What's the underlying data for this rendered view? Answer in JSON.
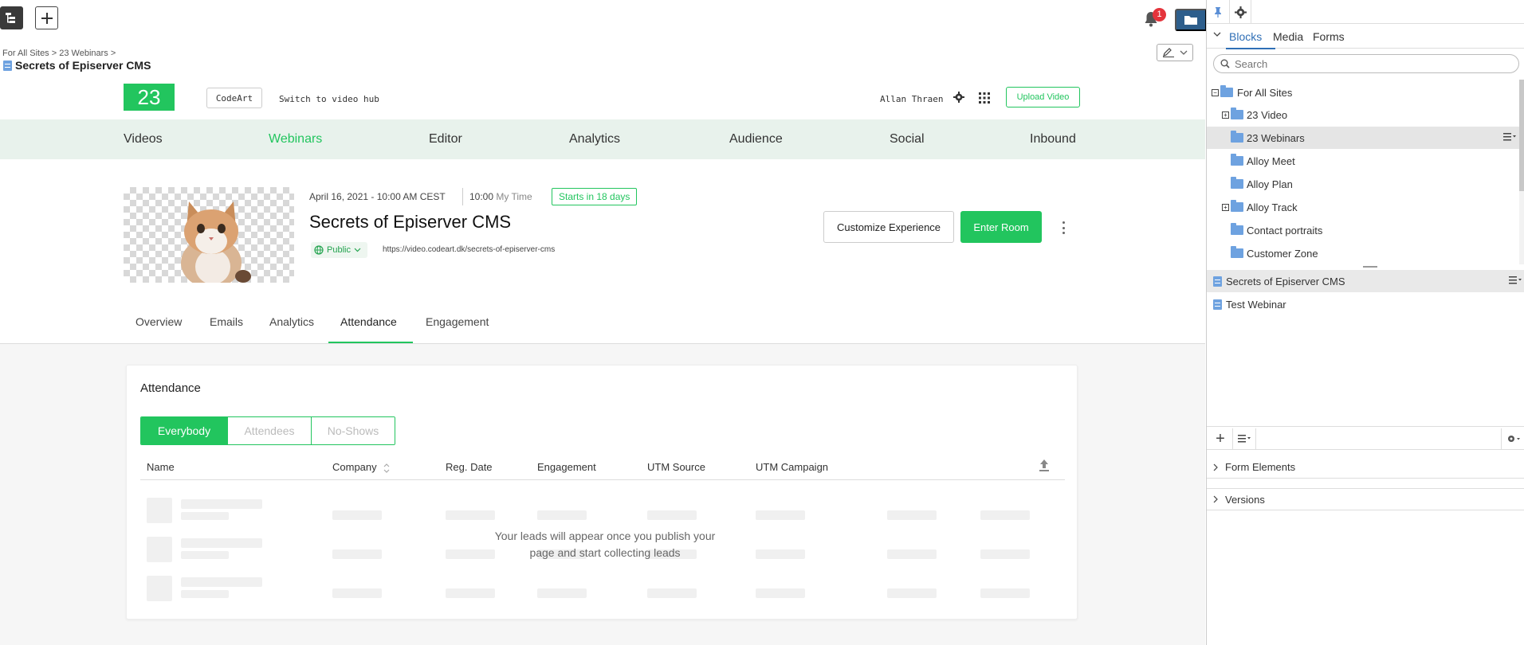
{
  "topbar": {
    "notifications_count": "1"
  },
  "breadcrumb": {
    "items": [
      "For All Sites",
      "23 Webinars"
    ],
    "separator": ">"
  },
  "page": {
    "title": "Secrets of Episerver CMS"
  },
  "app": {
    "logo": "23",
    "codeart_label": "CodeArt",
    "switch_label": "Switch to video hub",
    "user_name": "Allan Thraen",
    "upload_label": "Upload Video",
    "accent_color": "#22c55e"
  },
  "nav": {
    "items": [
      "Videos",
      "Webinars",
      "Editor",
      "Analytics",
      "Audience",
      "Social",
      "Inbound"
    ],
    "active": "Webinars"
  },
  "event": {
    "date": "April 16, 2021 - 10:00 AM CEST",
    "my_time_value": "10:00",
    "my_time_label": "My Time",
    "starts_badge": "Starts in 18 days",
    "title": "Secrets of Episerver CMS",
    "visibility": "Public",
    "url": "https://video.codeart.dk/secrets-of-episerver-cms",
    "customize_label": "Customize Experience",
    "enter_room_label": "Enter Room"
  },
  "subtabs": {
    "items": [
      "Overview",
      "Emails",
      "Analytics",
      "Attendance",
      "Engagement"
    ],
    "active": "Attendance"
  },
  "attendance": {
    "title": "Attendance",
    "filters": [
      "Everybody",
      "Attendees",
      "No-Shows"
    ],
    "active_filter": "Everybody",
    "columns": [
      "Name",
      "Company",
      "Reg. Date",
      "Engagement",
      "UTM Source",
      "UTM Campaign"
    ],
    "empty_message_line1": "Your leads will appear once you publish your",
    "empty_message_line2": "page and start collecting leads"
  },
  "right_panel": {
    "tabs": [
      "Blocks",
      "Media",
      "Forms"
    ],
    "active_tab": "Blocks",
    "search_placeholder": "Search",
    "tree": [
      {
        "label": "For All Sites",
        "expand": "−"
      },
      {
        "label": "23 Video",
        "expand": "+"
      },
      {
        "label": "23 Webinars",
        "expand": "",
        "selected": true
      },
      {
        "label": "Alloy Meet",
        "expand": ""
      },
      {
        "label": "Alloy Plan",
        "expand": ""
      },
      {
        "label": "Alloy Track",
        "expand": "+"
      },
      {
        "label": "Contact portraits",
        "expand": ""
      },
      {
        "label": "Customer Zone",
        "expand": ""
      }
    ],
    "pages": [
      {
        "label": "Secrets of Episerver CMS",
        "selected": true
      },
      {
        "label": "Test Webinar"
      }
    ],
    "sections": [
      "Form Elements",
      "Versions"
    ],
    "folder_color": "#6ea2e0",
    "link_color": "#2f6fb6"
  }
}
